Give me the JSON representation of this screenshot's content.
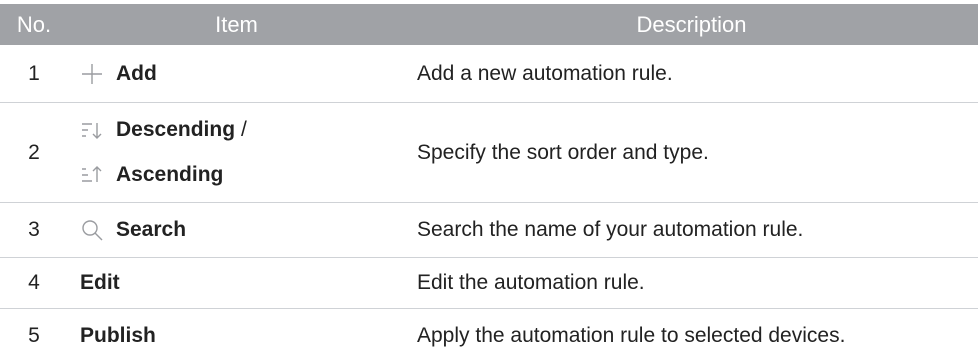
{
  "header": {
    "no": "No.",
    "item": "Item",
    "description": "Description"
  },
  "rows": [
    {
      "no": "1",
      "icon": "plus-icon",
      "item": "Add",
      "description": "Add a new automation rule."
    },
    {
      "no": "2",
      "icons": [
        "sort-descending-icon",
        "sort-ascending-icon"
      ],
      "item_a": "Descending",
      "separator": "/",
      "item_b": "Ascending",
      "description": "Specify the sort order and type."
    },
    {
      "no": "3",
      "icon": "search-icon",
      "item": "Search",
      "description": "Search the name of your automation rule."
    },
    {
      "no": "4",
      "item": "Edit",
      "description": "Edit the automation rule."
    },
    {
      "no": "5",
      "item": "Publish",
      "description": "Apply the automation rule to selected devices."
    }
  ],
  "colors": {
    "header_bg": "#a0a2a6",
    "header_text": "#ffffff",
    "row_border": "#cfd2d6",
    "icon_stroke": "#9a9ca0"
  }
}
